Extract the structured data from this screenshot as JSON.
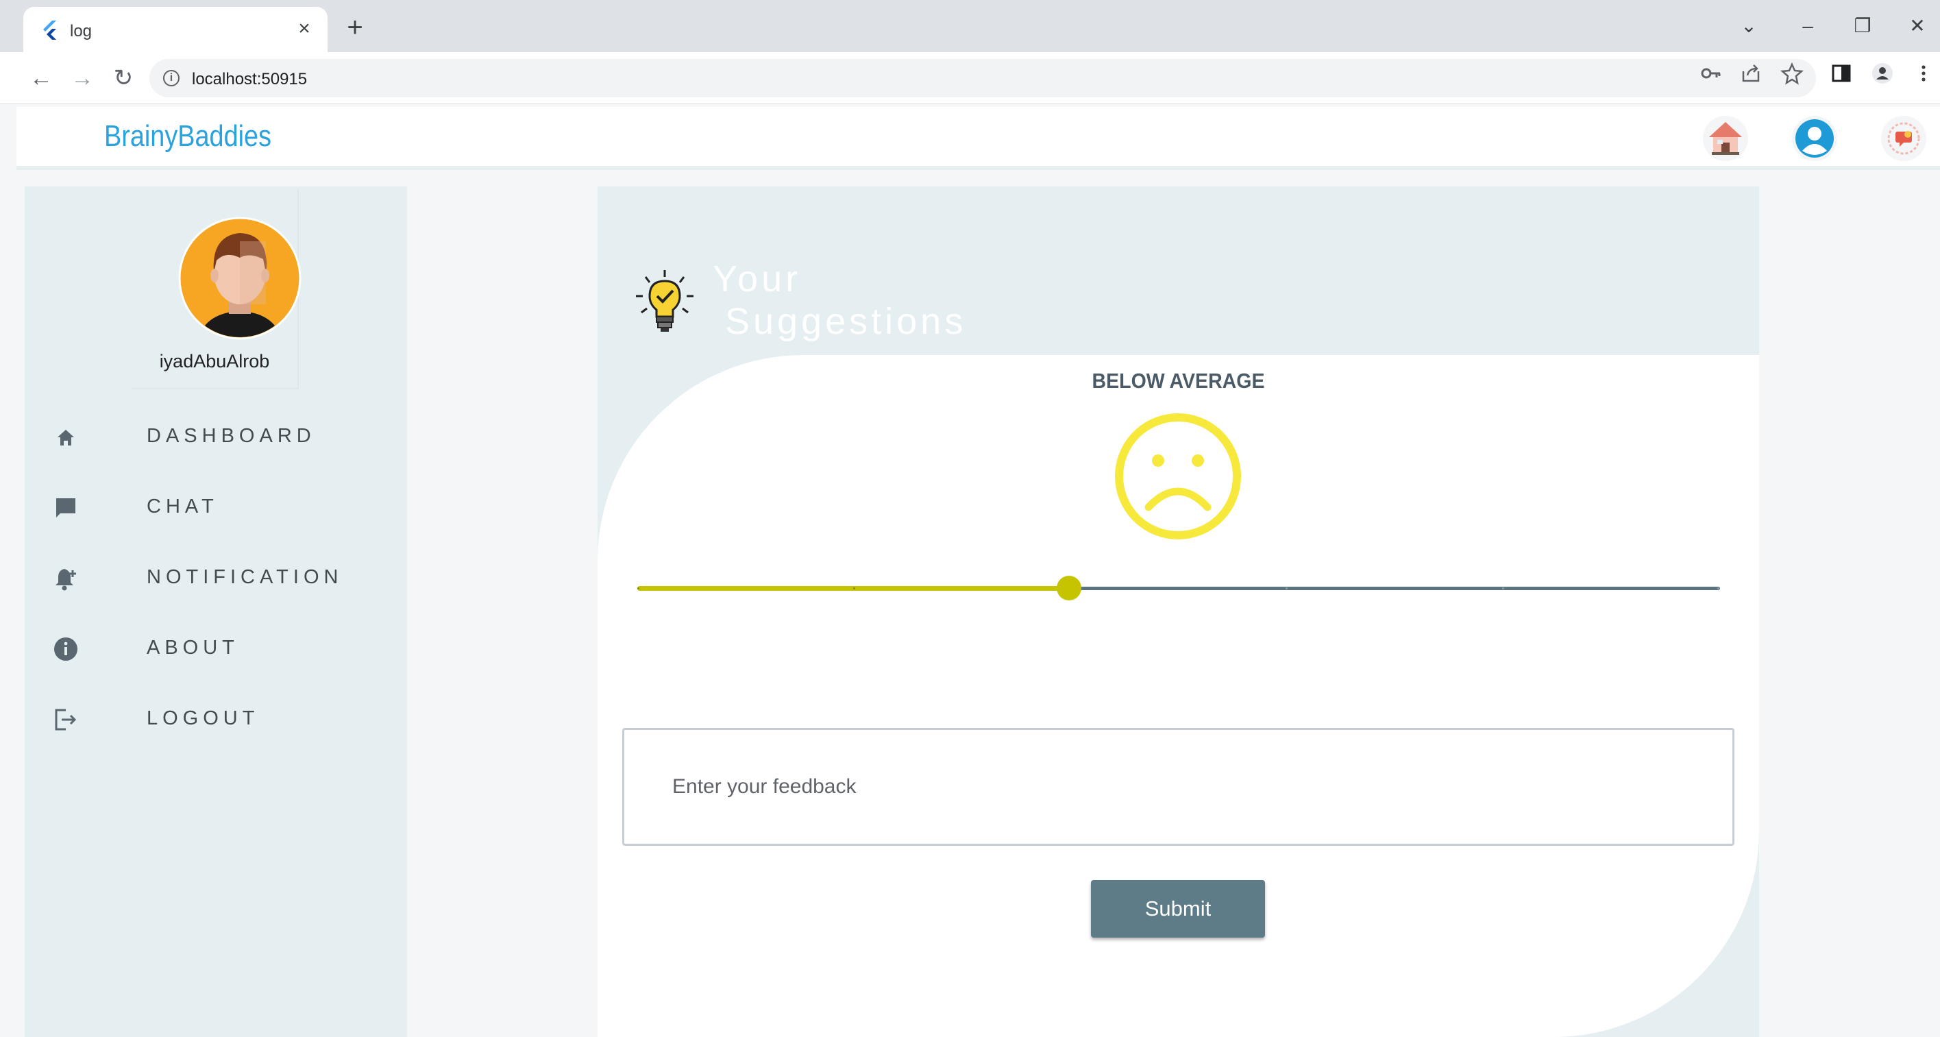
{
  "browser": {
    "tab_title": "log",
    "tab_close": "×",
    "new_tab": "+",
    "url": "localhost:50915",
    "window_controls": {
      "dropdown": "⌄",
      "minimize": "–",
      "restore": "❐",
      "close": "✕"
    },
    "nav": {
      "back": "←",
      "forward": "→",
      "reload": "↻"
    },
    "omnibox_icons": [
      "key-icon",
      "share-icon",
      "star-icon",
      "sidebar-icon",
      "profile-icon",
      "menu-icon"
    ]
  },
  "app": {
    "brand": "BrainyBaddies",
    "header_icons": [
      "home-icon",
      "account-icon",
      "chat-badge-icon"
    ]
  },
  "sidebar": {
    "username": "iyadAbuAlrob",
    "items": [
      {
        "label": "DASHBOARD",
        "icon": "home-icon"
      },
      {
        "label": "CHAT",
        "icon": "chat-icon"
      },
      {
        "label": "NOTIFICATION",
        "icon": "notification-add-icon"
      },
      {
        "label": "ABOUT",
        "icon": "info-icon"
      },
      {
        "label": "LOGOUT",
        "icon": "logout-icon"
      }
    ]
  },
  "main": {
    "title_line1": "Your",
    "title_line2": "Suggestions",
    "rating_label": "BELOW AVERAGE",
    "rating_icon": "sad-face-icon",
    "slider": {
      "min": 0,
      "max": 5,
      "value": 2
    },
    "feedback_placeholder": "Enter your feedback",
    "submit_label": "Submit"
  },
  "colors": {
    "accent_brand": "#2aa2de",
    "slider_active": "#c6c400",
    "slider_inactive": "#5c7380",
    "face": "#f7e83c",
    "button": "#5e7c88",
    "panel": "#e5eef0"
  }
}
